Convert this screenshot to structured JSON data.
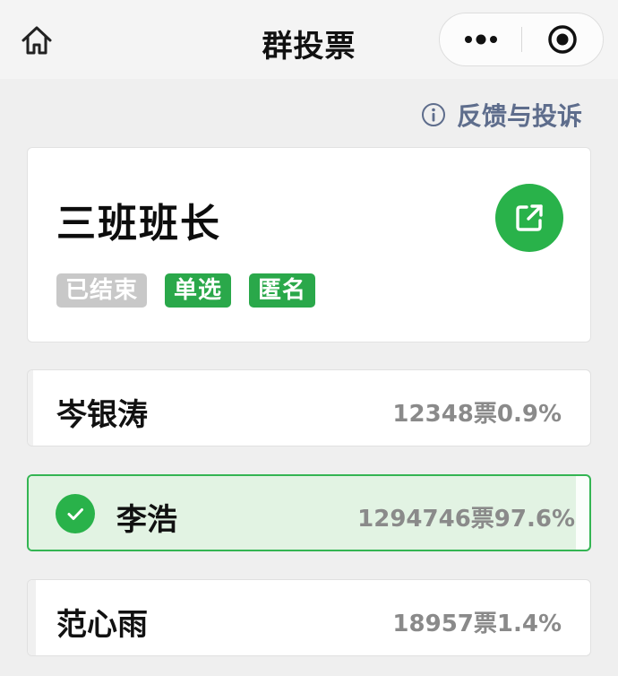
{
  "navbar": {
    "title": "群投票",
    "home_icon": "home-icon",
    "more_icon": "more-dots-icon",
    "close_icon": "target-close-icon"
  },
  "feedback": {
    "label": "反馈与投诉",
    "icon": "info-icon",
    "color": "#5e6d8c"
  },
  "poll": {
    "title": "三班班长",
    "share_icon": "share-icon",
    "tags": [
      "已结束",
      "单选",
      "匿名"
    ]
  },
  "options": [
    {
      "name": "岑银涛",
      "votes": "12348票",
      "percent": "0.9%",
      "percent_value": 0.9,
      "selected": false
    },
    {
      "name": "李浩",
      "votes": "1294746票",
      "percent": "97.6%",
      "percent_value": 97.6,
      "selected": true
    },
    {
      "name": "范心雨",
      "votes": "18957票",
      "percent": "1.4%",
      "percent_value": 1.4,
      "selected": false
    }
  ],
  "colors": {
    "accent_green": "#29b24a",
    "tag_ended": "#c8c8c8",
    "selected_fill": "#e2f3e3"
  }
}
